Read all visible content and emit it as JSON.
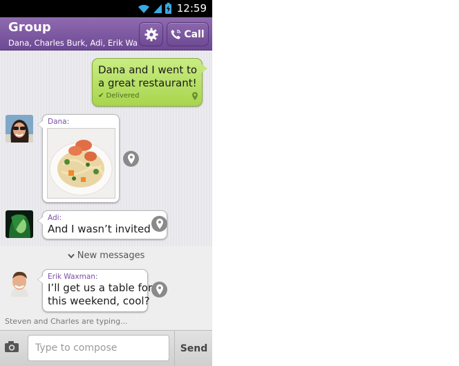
{
  "status_bar": {
    "time": "12:59"
  },
  "header": {
    "title": "Group",
    "subtitle": "Dana, Charles Burk, Adi, Erik Wax...",
    "call_label": "Call"
  },
  "messages": [
    {
      "direction": "outgoing",
      "lines": [
        "Dana and I went to",
        "a great restaurant!"
      ],
      "status": "✔ Delivered"
    },
    {
      "direction": "incoming",
      "sender": "Dana:",
      "type": "image",
      "image_desc": "food-photo"
    },
    {
      "direction": "incoming",
      "sender": "Adi:",
      "lines": [
        "And I wasn’t invited"
      ]
    },
    {
      "direction": "incoming",
      "sender": "Erik Waxman:",
      "lines": [
        "I’ll get us a table for",
        "this weekend, cool?"
      ]
    }
  ],
  "new_messages_label": "New messages",
  "typing_indicator": "Steven and Charles are typing...",
  "compose": {
    "placeholder": "Type to compose",
    "value": "",
    "send_label": "Send"
  },
  "colors": {
    "header": "#7b57a0",
    "outgoing_bubble": "#b7df66",
    "sender_name": "#7b4ea3"
  },
  "icons": [
    "wifi-icon",
    "signal-icon",
    "battery-icon",
    "gear-icon",
    "phone-icon",
    "location-pin-icon",
    "chevron-down-icon",
    "camera-icon",
    "checkmark-icon"
  ]
}
